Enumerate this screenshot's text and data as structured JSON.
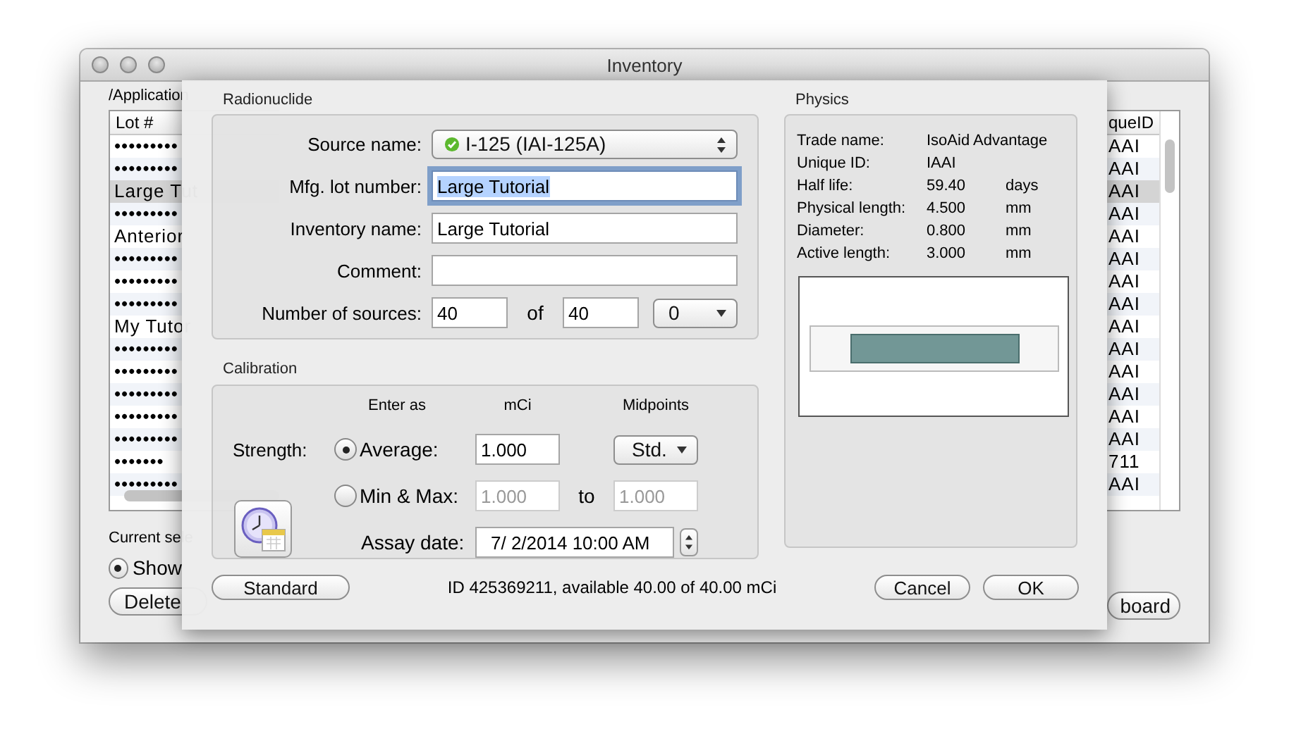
{
  "window": {
    "title": "Inventory"
  },
  "background": {
    "path": "/Application",
    "columns": [
      "Lot #",
      "queID"
    ],
    "rows": [
      {
        "lot": "•••••••••",
        "unique_id": "AAI",
        "selected": false
      },
      {
        "lot": "•••••••••",
        "unique_id": "AAI",
        "selected": false
      },
      {
        "lot": "Large Tut",
        "unique_id": "AAI",
        "selected": true
      },
      {
        "lot": "•••••••••",
        "unique_id": "AAI",
        "selected": false
      },
      {
        "lot": "Anterior",
        "unique_id": "AAI",
        "selected": false
      },
      {
        "lot": "•••••••••",
        "unique_id": "AAI",
        "selected": false
      },
      {
        "lot": "•••••••••",
        "unique_id": "AAI",
        "selected": false
      },
      {
        "lot": "•••••••••",
        "unique_id": "AAI",
        "selected": false
      },
      {
        "lot": "My Tutor",
        "unique_id": "AAI",
        "selected": false
      },
      {
        "lot": "•••••••••",
        "unique_id": "AAI",
        "selected": false
      },
      {
        "lot": "•••••••••",
        "unique_id": "AAI",
        "selected": false
      },
      {
        "lot": "•••••••••",
        "unique_id": "AAI",
        "selected": false
      },
      {
        "lot": "•••••••••",
        "unique_id": "AAI",
        "selected": false
      },
      {
        "lot": "•••••••••",
        "unique_id": "AAI",
        "selected": false
      },
      {
        "lot": "•••••••",
        "unique_id": "711",
        "selected": false
      },
      {
        "lot": "•••••••••",
        "unique_id": "AAI",
        "selected": false
      }
    ],
    "current_selection": "Current sele",
    "show_all": {
      "label": "Show",
      "selected": true
    },
    "left_button": "Delete",
    "right_button": "board"
  },
  "dialog": {
    "radionuclide": {
      "title": "Radionuclide",
      "source_name": {
        "label": "Source name:",
        "value": "I-125 (IAI-125A)"
      },
      "lot_number": {
        "label": "Mfg. lot number:",
        "value": "Large Tutorial",
        "focused": true
      },
      "inventory_name": {
        "label": "Inventory name:",
        "value": "Large Tutorial"
      },
      "comment": {
        "label": "Comment:"
      },
      "sources": {
        "label": "Number of sources:",
        "value": "40",
        "of_label": "of",
        "total": "40",
        "menu": "0"
      }
    },
    "calibration": {
      "title": "Calibration",
      "headers": [
        "Enter as",
        "mCi",
        "Midpoints"
      ],
      "strength_label": "Strength:",
      "modes": [
        {
          "label": "Average:",
          "selected": true,
          "value": "1.000"
        },
        {
          "label": "Min & Max:",
          "selected": false,
          "value": "1.000",
          "to_label": "to",
          "to_value": "1.000"
        }
      ],
      "midpoints": "Std.",
      "assay_label": "Assay date:",
      "assay_date": "7/  2/2014 10:00 AM"
    },
    "physics": {
      "title": "Physics",
      "rows": [
        {
          "label": "Trade name:",
          "value": "IsoAid Advantage"
        },
        {
          "label": "Unique ID:",
          "value": "IAAI"
        },
        {
          "label": "Half life:",
          "value": "59.40",
          "unit": "days"
        },
        {
          "label": "Physical length:",
          "value": "4.500",
          "unit": "mm"
        },
        {
          "label": "Diameter:",
          "value": "0.800",
          "unit": "mm"
        },
        {
          "label": "Active length:",
          "value": "3.000",
          "unit": "mm"
        }
      ]
    },
    "footer": {
      "standard": "Standard",
      "status": "ID 425369211, available 40.00 of 40.00 mCi",
      "buttons": [
        "Cancel",
        "OK"
      ]
    }
  }
}
